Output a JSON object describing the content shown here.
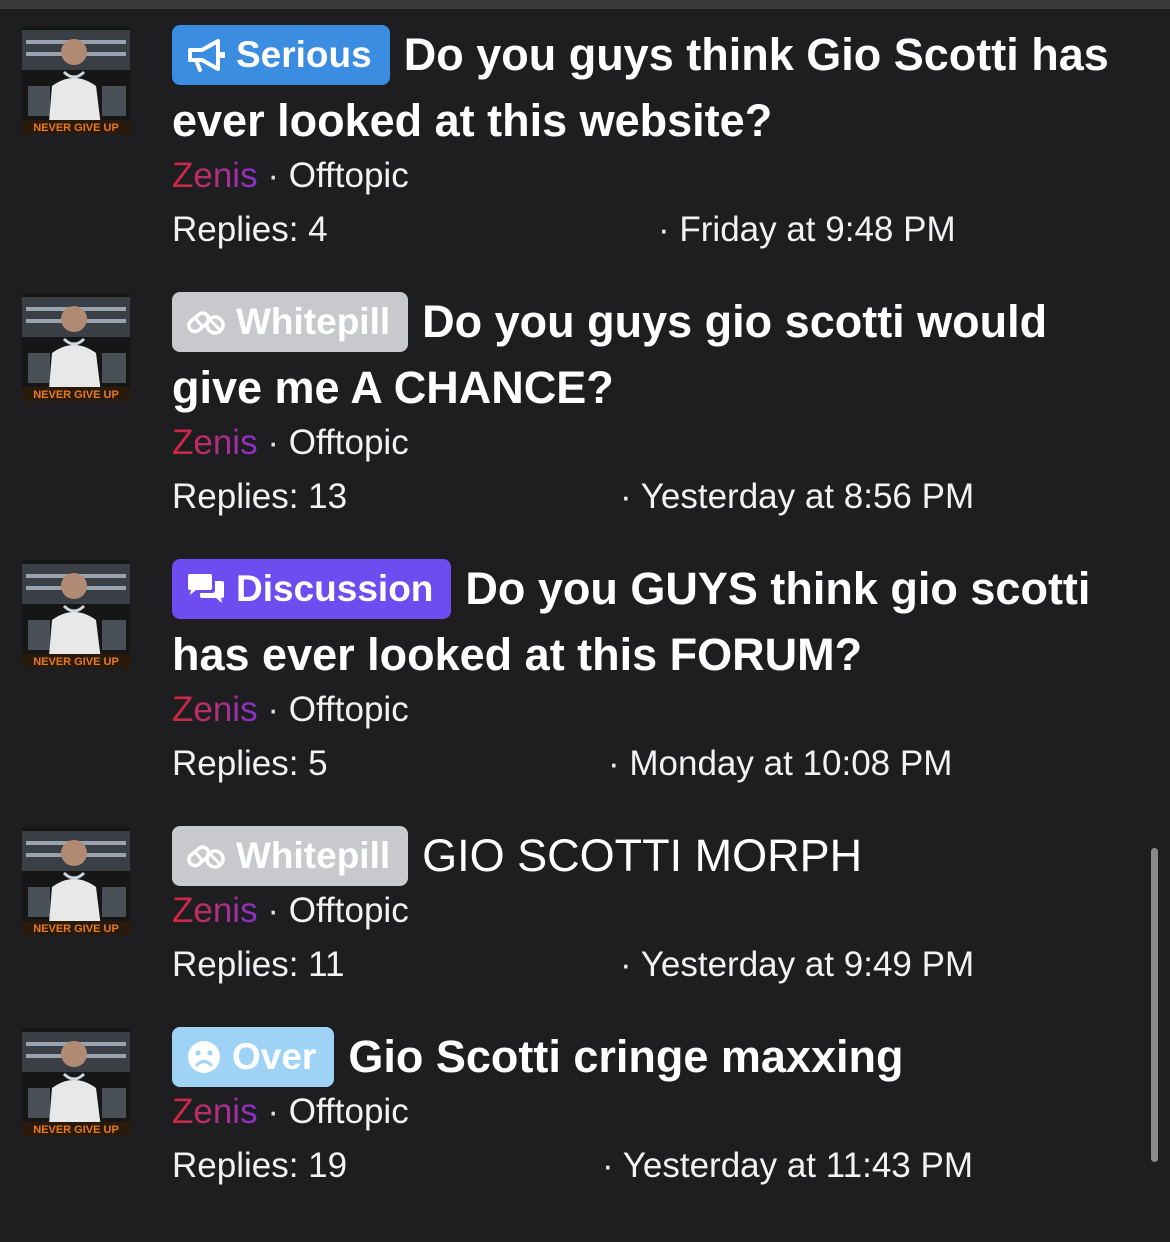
{
  "threads": [
    {
      "prefix": {
        "label": "Serious",
        "icon": "megaphone-icon",
        "color": "#3b8de2"
      },
      "title": "Do you guys think Gio Scotti has ever looked at this website?",
      "author": "Zenis",
      "separator": "·",
      "forum": "Offtopic",
      "replies": "Replies: 4",
      "last_post": "· Friday at 9:48 PM"
    },
    {
      "prefix": {
        "label": "Whitepill",
        "icon": "pills-icon",
        "color": "#c7c9cc"
      },
      "title": "Do you guys gio scotti would give me A CHANCE?",
      "author": "Zenis",
      "separator": "·",
      "forum": "Offtopic",
      "replies": "Replies: 13",
      "last_post": "· Yesterday at 8:56 PM"
    },
    {
      "prefix": {
        "label": "Discussion",
        "icon": "chat-bubbles-icon",
        "color": "#6d4cf0"
      },
      "title": "Do you GUYS think gio scotti has ever looked at this FORUM?",
      "author": "Zenis",
      "separator": "·",
      "forum": "Offtopic",
      "replies": "Replies: 5",
      "last_post": "· Monday at 10:08 PM"
    },
    {
      "prefix": {
        "label": "Whitepill",
        "icon": "pills-icon",
        "color": "#c7c9cc"
      },
      "title": "GIO SCOTTI MORPH",
      "author": "Zenis",
      "separator": "·",
      "forum": "Offtopic",
      "replies": "Replies: 11",
      "last_post": "· Yesterday at 9:49 PM"
    },
    {
      "prefix": {
        "label": "Over",
        "icon": "frown-face-icon",
        "color": "#9fd3f5"
      },
      "title": "Gio Scotti cringe maxxing",
      "author": "Zenis",
      "separator": "·",
      "forum": "Offtopic",
      "replies": "Replies: 19",
      "last_post": "· Yesterday at 11:43 PM"
    }
  ],
  "avatar_banner_text": "NEVER GIVE UP",
  "colors": {
    "background": "#1e1e20",
    "author_gradient_start": "#d2263a",
    "author_gradient_end": "#8a2fd0"
  }
}
